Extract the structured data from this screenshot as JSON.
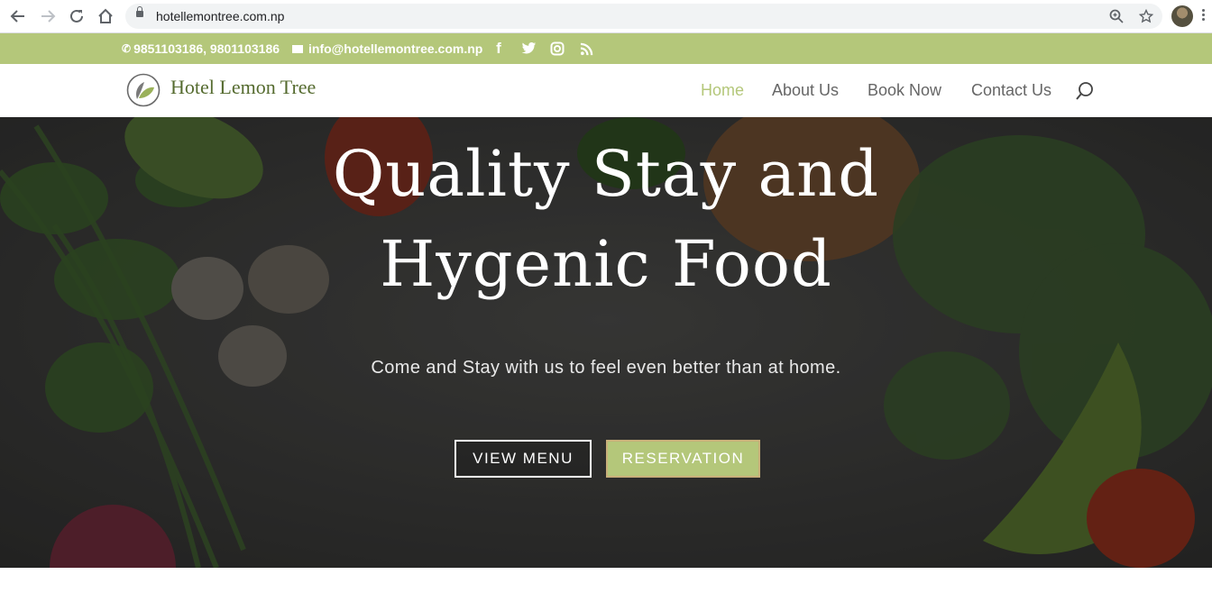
{
  "browser": {
    "url": "hotellemontree.com.np",
    "icons": [
      "back-icon",
      "forward-icon",
      "reload-icon",
      "home-icon",
      "lock-icon",
      "zoom-icon",
      "star-icon",
      "avatar",
      "menu-icon"
    ]
  },
  "topbar": {
    "phone": "9851103186, 9801103186",
    "email": "info@hotellemontree.com.np",
    "social_icons": [
      "facebook-icon",
      "twitter-icon",
      "instagram-icon",
      "rss-icon"
    ],
    "bg_color": "#b4c77a"
  },
  "header": {
    "logo_text": "Hotel Lemon Tree",
    "nav": [
      {
        "label": "Home",
        "active": true
      },
      {
        "label": "About Us",
        "active": false
      },
      {
        "label": "Book Now",
        "active": false
      },
      {
        "label": "Contact Us",
        "active": false
      }
    ],
    "active_color": "#b4c77a"
  },
  "hero": {
    "title_line1": "Quality Stay and",
    "title_line2": "Hygenic Food",
    "subtitle": "Come and Stay with us to feel even better than at home.",
    "button_menu": "VIEW MENU",
    "button_reservation": "RESERVATION",
    "reservation_bg": "#b4c77a"
  }
}
